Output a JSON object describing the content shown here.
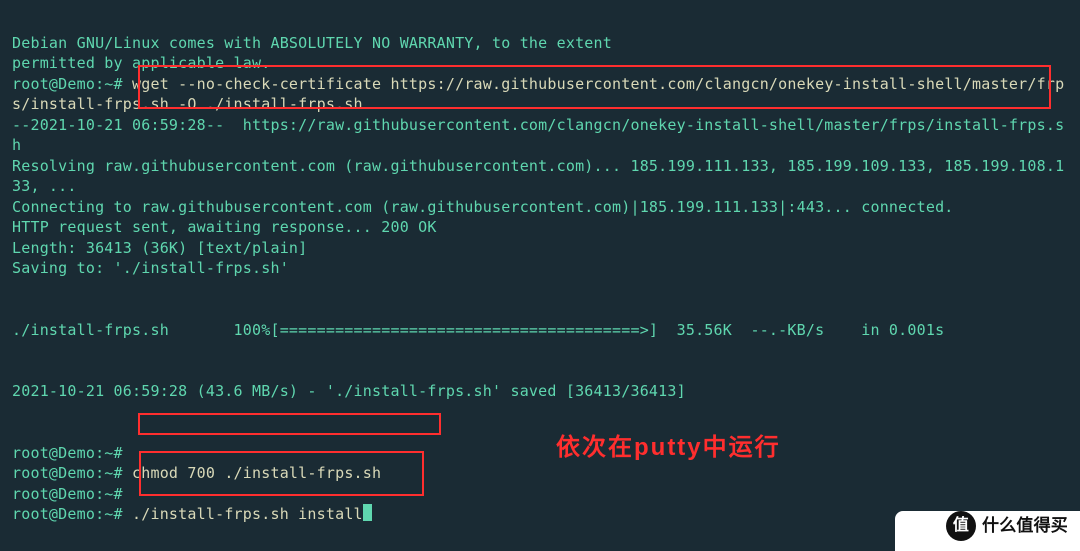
{
  "lines": {
    "l1": "Debian GNU/Linux comes with ABSOLUTELY NO WARRANTY, to the extent",
    "l2": "permitted by applicable law.",
    "prompt1": "root@Demo:~#",
    "cmd1": " wget --no-check-certificate https://raw.githubusercontent.com/clangcn/onekey-install-shell/master/frps/install-frps.sh -O ./install-frps.sh",
    "l4": "--2021-10-21 06:59:28--  https://raw.githubusercontent.com/clangcn/onekey-install-shell/master/frps/install-frps.sh",
    "l5": "Resolving raw.githubusercontent.com (raw.githubusercontent.com)... 185.199.111.133, 185.199.109.133, 185.199.108.133, ...",
    "l6": "Connecting to raw.githubusercontent.com (raw.githubusercontent.com)|185.199.111.133|:443... connected.",
    "l7": "HTTP request sent, awaiting response... 200 OK",
    "l8": "Length: 36413 (36K) [text/plain]",
    "l9": "Saving to: './install-frps.sh'",
    "l10": "./install-frps.sh       100%[=======================================>]  35.56K  --.-KB/s    in 0.001s",
    "l11": "2021-10-21 06:59:28 (43.6 MB/s) - './install-frps.sh' saved [36413/36413]",
    "prompt2": "root@Demo:~#",
    "prompt3": "root@Demo:~#",
    "cmd2": " chmod 700 ./install-frps.sh",
    "prompt4": "root@Demo:~#",
    "prompt5": "root@Demo:~#",
    "cmd3": " ./install-frps.sh install"
  },
  "annotation": "依次在putty中运行",
  "watermark": {
    "badge": "值",
    "text": "什么值得买"
  }
}
